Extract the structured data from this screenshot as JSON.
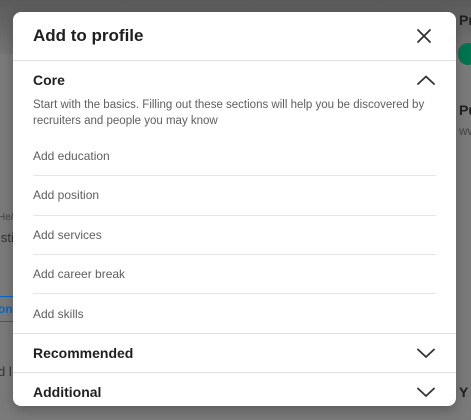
{
  "modal": {
    "title": "Add to profile",
    "close_icon": "close-icon"
  },
  "sections": {
    "core": {
      "title": "Core",
      "expanded": true,
      "description": "Start with the basics. Filling out these sections will help you be discovered by recruiters and people you may know",
      "items": [
        "Add education",
        "Add position",
        "Add services",
        "Add career break",
        "Add skills"
      ]
    },
    "recommended": {
      "title": "Recommended",
      "expanded": false
    },
    "additional": {
      "title": "Additional",
      "expanded": false
    }
  },
  "background": {
    "left_fragments": [
      "He/",
      "isti",
      "on",
      "d l"
    ],
    "right_fragments": [
      "Pr",
      "Pu",
      "ww",
      "Y"
    ]
  },
  "colors": {
    "modal_bg": "#ffffff",
    "backdrop": "#7a7a7a",
    "text_primary": "#1f1f1f",
    "text_secondary": "#5e5e5e",
    "divider": "#e0e0e0",
    "accent_green": "#01754f",
    "link_blue": "#0a66c2"
  }
}
